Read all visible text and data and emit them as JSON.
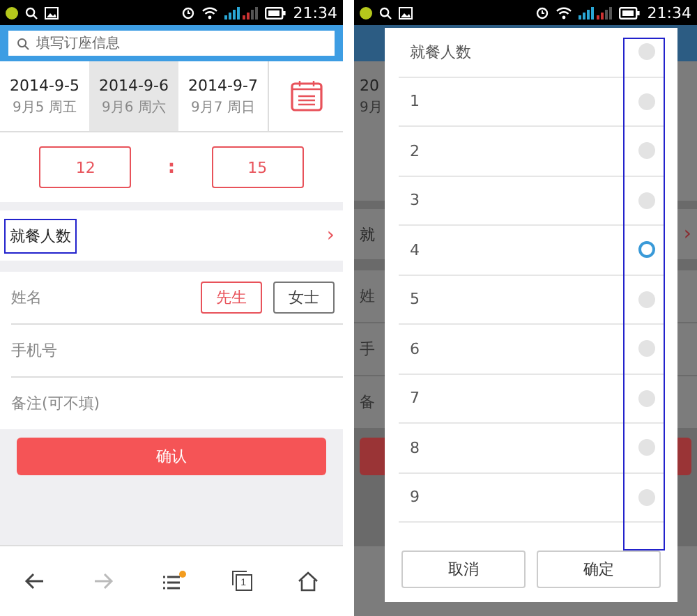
{
  "left": {
    "status_time": "21:34",
    "search": {
      "placeholder": "填写订座信息"
    },
    "dates": [
      {
        "date": "2014-9-5",
        "weekday": "9月5 周五",
        "selected": false
      },
      {
        "date": "2014-9-6",
        "weekday": "9月6 周六",
        "selected": true
      },
      {
        "date": "2014-9-7",
        "weekday": "9月7 周日",
        "selected": false
      }
    ],
    "time": {
      "hour": "12",
      "separator": ":",
      "minute": "15"
    },
    "diners": {
      "label": "就餐人数",
      "highlighted": true,
      "chevron": "›"
    },
    "form": {
      "name_placeholder": "姓名",
      "titles": [
        {
          "label": "先生",
          "selected": true
        },
        {
          "label": "女士",
          "selected": false
        }
      ],
      "phone_placeholder": "手机号",
      "note_placeholder": "备注(可不填)"
    },
    "confirm": "确认",
    "nav": [
      {
        "kind": "back",
        "disabled": false
      },
      {
        "kind": "forward",
        "disabled": true
      },
      {
        "kind": "menu",
        "badge": true
      },
      {
        "kind": "tabs",
        "count": "1"
      },
      {
        "kind": "home"
      }
    ]
  },
  "right": {
    "status_time": "21:34",
    "background": {
      "date": "20",
      "weekday": "9月",
      "diners": "就",
      "chevron": "›",
      "name": "姓",
      "phone": "手",
      "note": "备"
    },
    "dialog": {
      "title": "就餐人数",
      "title_selected": false,
      "highlighted": true,
      "options": [
        {
          "label": "1",
          "selected": false
        },
        {
          "label": "2",
          "selected": false
        },
        {
          "label": "3",
          "selected": false
        },
        {
          "label": "4",
          "selected": true
        },
        {
          "label": "5",
          "selected": false
        },
        {
          "label": "6",
          "selected": false
        },
        {
          "label": "7",
          "selected": false
        },
        {
          "label": "8",
          "selected": false
        },
        {
          "label": "9",
          "selected": false
        }
      ],
      "buttons": [
        "取消",
        "确定"
      ]
    }
  }
}
